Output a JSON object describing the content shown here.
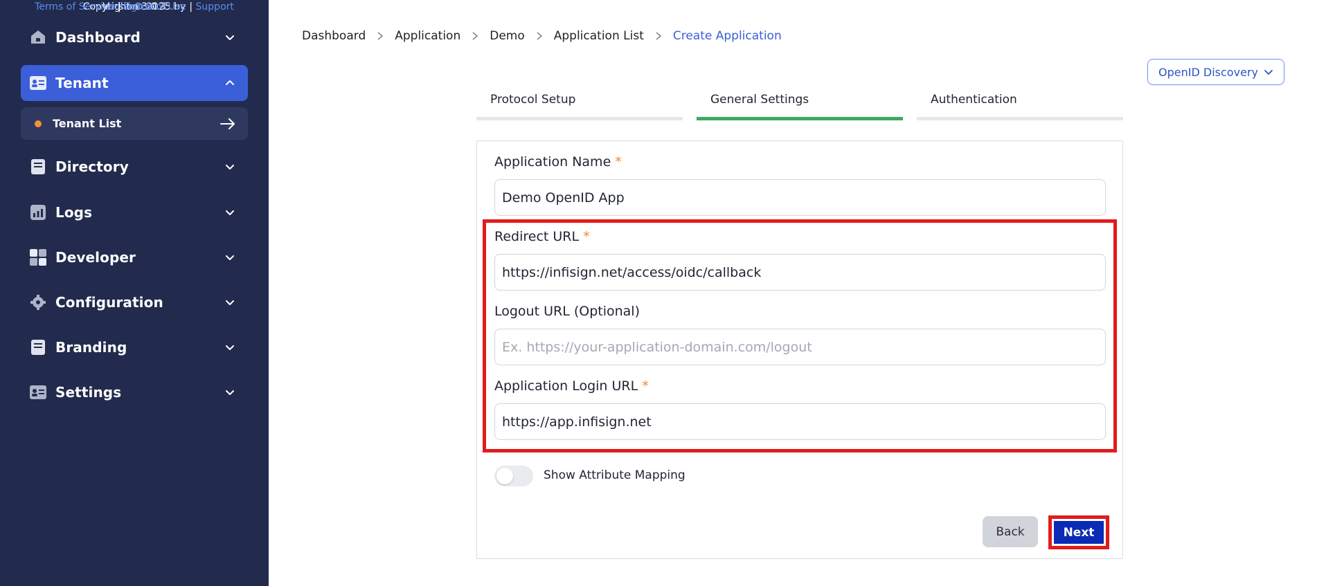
{
  "sidebar": {
    "items": [
      {
        "label": "Dashboard",
        "icon": "home-icon"
      },
      {
        "label": "Tenant",
        "icon": "id-card-icon"
      },
      {
        "label": "Directory",
        "icon": "document-icon"
      },
      {
        "label": "Logs",
        "icon": "chart-icon"
      },
      {
        "label": "Developer",
        "icon": "grid-icon"
      },
      {
        "label": "Configuration",
        "icon": "gear-icon"
      },
      {
        "label": "Branding",
        "icon": "document-icon"
      },
      {
        "label": "Settings",
        "icon": "id-card-icon"
      }
    ],
    "sub_item": {
      "label": "Tenant List"
    }
  },
  "footer": {
    "version": "Version 3.0.3",
    "copyright": "Copyright © 2025 by",
    "company": "Infisign Inc",
    "terms_service": "Terms of Service",
    "terms_use": "Terms of Use",
    "support": "Support",
    "separator": "|"
  },
  "breadcrumb": [
    "Dashboard",
    "Application",
    "Demo",
    "Application List",
    "Create Application"
  ],
  "discovery_button": "OpenID Discovery",
  "tabs": [
    "Protocol Setup",
    "General Settings",
    "Authentication"
  ],
  "active_tab": "General Settings",
  "form": {
    "app_name_label": "Application Name",
    "app_name_value": "Demo OpenID App",
    "redirect_label": "Redirect URL",
    "redirect_value": "https://infisign.net/access/oidc/callback",
    "logout_label": "Logout URL (Optional)",
    "logout_placeholder": "Ex. https://your-application-domain.com/logout",
    "login_label": "Application Login URL",
    "login_value": "https://app.infisign.net",
    "required_mark": "*",
    "toggle_label": "Show Attribute Mapping",
    "back_label": "Back",
    "next_label": "Next"
  },
  "colors": {
    "sidebar_bg": "#222b4d",
    "active_nav": "#3a5fd9",
    "accent_green": "#3dab5c",
    "required": "#ef8a2a",
    "primary_button": "#0a2bb5",
    "highlight": "#e21b1b"
  }
}
